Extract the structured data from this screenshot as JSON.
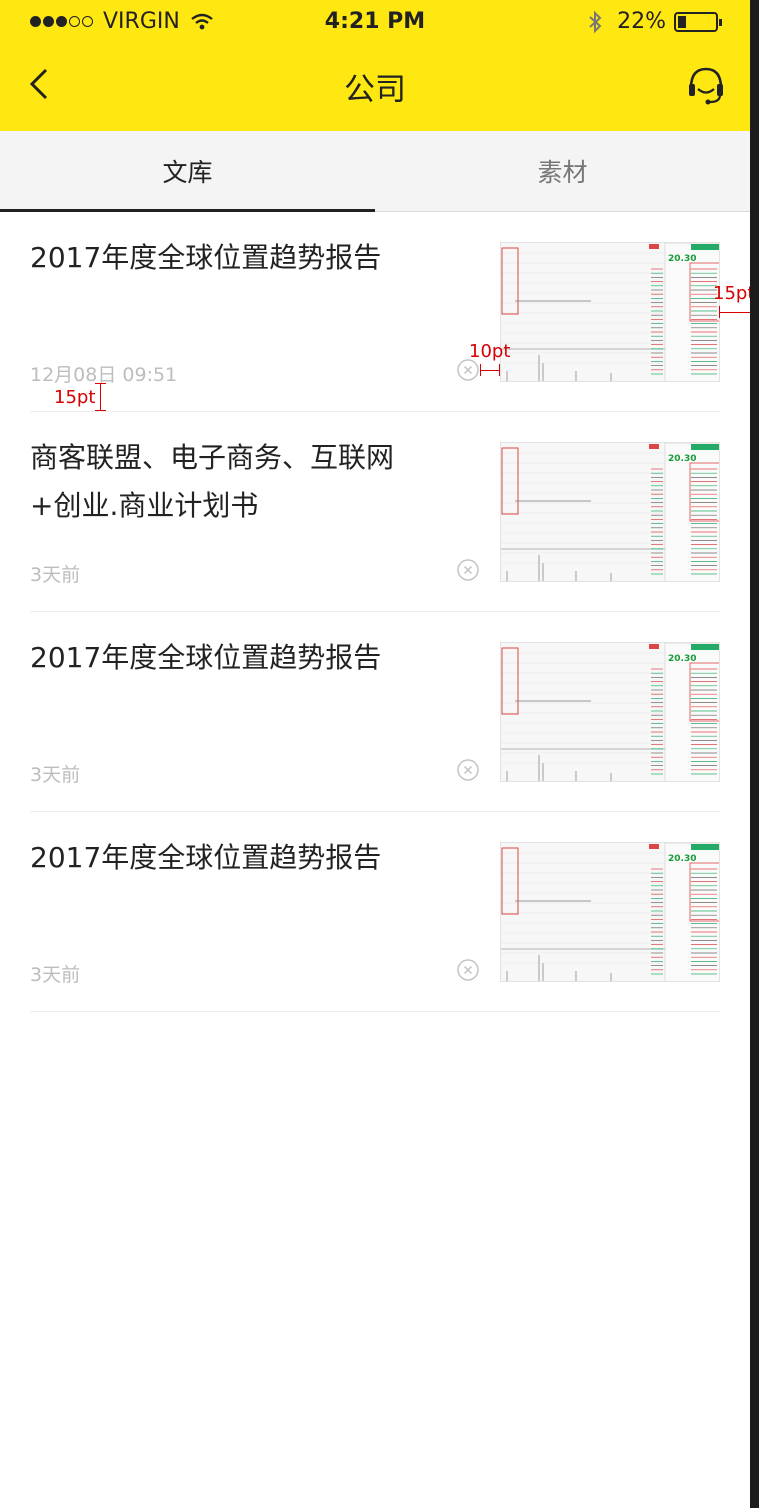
{
  "status_bar": {
    "carrier": "VIRGIN",
    "time": "4:21 PM",
    "battery": "22%",
    "signal_icon": "signal-dots-icon",
    "wifi_icon": "wifi-icon",
    "bluetooth_icon": "bluetooth-icon"
  },
  "nav": {
    "title": "公司",
    "back_icon": "chevron-left-icon",
    "service_icon": "headset-icon"
  },
  "tabs": [
    {
      "label": "文库",
      "active": true
    },
    {
      "label": "素材",
      "active": false
    }
  ],
  "items": [
    {
      "title": "2017年度全球位置趋势报告",
      "time": "12月08日  09:51"
    },
    {
      "title": "商客联盟、电子商务、互联网+创业.商业计划书",
      "time": "3天前"
    },
    {
      "title": "2017年度全球位置趋势报告",
      "time": "3天前"
    },
    {
      "title": "2017年度全球位置趋势报告",
      "time": "3天前"
    }
  ],
  "thumbnail": {
    "price": "20.30"
  },
  "annotations": {
    "right_margin": "15pt",
    "gap": "10pt",
    "bottom_margin": "15pt"
  },
  "colors": {
    "header": "#ffe812",
    "tab_bg": "#f4f4f4",
    "annotation": "#d80000"
  }
}
